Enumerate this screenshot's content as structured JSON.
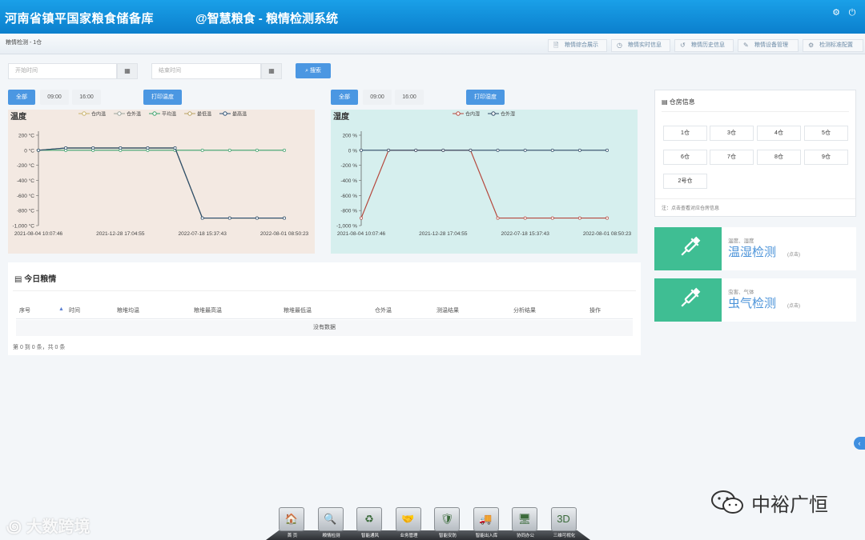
{
  "header": {
    "org_title": "河南省镇平国家粮食储备库",
    "system_title": "@智慧粮食 - 粮情检测系统"
  },
  "subbar": {
    "breadcrumb": "粮情检测 - 1仓",
    "tabs": [
      {
        "label": "粮情综合展示",
        "icon": "document-icon"
      },
      {
        "label": "粮情实时信息",
        "icon": "clock-icon"
      },
      {
        "label": "粮情历史信息",
        "icon": "history-icon"
      },
      {
        "label": "粮情设备管理",
        "icon": "wrench-icon"
      },
      {
        "label": "检测标准配置",
        "icon": "gear-icon"
      }
    ]
  },
  "search": {
    "start_placeholder": "开始时间",
    "end_placeholder": "结束时间",
    "button_label": "搜索"
  },
  "temp_controls": {
    "all": "全部",
    "t1": "09:00",
    "t2": "16:00",
    "print": "打印温度"
  },
  "hum_controls": {
    "all": "全部",
    "t1": "09:00",
    "t2": "16:00",
    "print": "打印湿度"
  },
  "chart_data": [
    {
      "type": "line",
      "title": "温度",
      "background": "#f3e9e2",
      "x": [
        "2021-08-04 10:07:46",
        "",
        "",
        "2021-12-28 17:04:55",
        "",
        "",
        "2022-07-18 15:37:43",
        "",
        "",
        "2022-08-01 08:50:23"
      ],
      "x_tick_labels": [
        "2021-08-04 10:07:46",
        "2021-12-28 17:04:55",
        "2022-07-18 15:37:43",
        "2022-08-01 08:50:23"
      ],
      "y_ticks": [
        "200 °C",
        "0 °C",
        "-200 °C",
        "-400 °C",
        "-600 °C",
        "-800 °C",
        "-1,000 °C"
      ],
      "ylim": [
        -1000,
        200
      ],
      "legend": [
        "仓内温",
        "仓外温",
        "平均温",
        "最低温",
        "最高温"
      ],
      "series": [
        {
          "name": "仓内温",
          "color": "#c8b26a",
          "values": [
            0,
            30,
            30,
            30,
            30,
            30,
            -900,
            -900,
            -900,
            -900
          ]
        },
        {
          "name": "仓外温",
          "color": "#9aa39a",
          "values": [
            0,
            30,
            30,
            30,
            30,
            30,
            -900,
            -900,
            -900,
            -900
          ]
        },
        {
          "name": "平均温",
          "color": "#3aa06a",
          "values": [
            0,
            0,
            0,
            0,
            0,
            0,
            0,
            0,
            0,
            0
          ]
        },
        {
          "name": "最低温",
          "color": "#b8a060",
          "values": [
            0,
            30,
            30,
            30,
            30,
            30,
            -900,
            -900,
            -900,
            -900
          ]
        },
        {
          "name": "最高温",
          "color": "#2b4f73",
          "values": [
            0,
            30,
            30,
            30,
            30,
            30,
            -900,
            -900,
            -900,
            -900
          ]
        }
      ]
    },
    {
      "type": "line",
      "title": "湿度",
      "background": "#d6efee",
      "x": [
        "2021-08-04 10:07:46",
        "",
        "",
        "2021-12-28 17:04:55",
        "",
        "",
        "2022-07-18 15:37:43",
        "",
        "",
        "2022-08-01 08:50:23"
      ],
      "x_tick_labels": [
        "2021-08-04 10:07:46",
        "2021-12-28 17:04:55",
        "2022-07-18 15:37:43",
        "2022-08-01 08:50:23"
      ],
      "y_ticks": [
        "200 %",
        "0 %",
        "-200 %",
        "-400 %",
        "-600 %",
        "-800 %",
        "-1,000 %"
      ],
      "ylim": [
        -1000,
        200
      ],
      "legend": [
        "仓内湿",
        "仓外湿"
      ],
      "series": [
        {
          "name": "仓内湿",
          "color": "#b5473c",
          "values": [
            -900,
            0,
            0,
            0,
            0,
            -900,
            -900,
            -900,
            -900,
            -900
          ]
        },
        {
          "name": "仓外湿",
          "color": "#2f4a66",
          "values": [
            0,
            0,
            0,
            0,
            0,
            0,
            0,
            0,
            0,
            0
          ]
        }
      ]
    }
  ],
  "today": {
    "title": "今日粮情",
    "columns": [
      "序号",
      "时间",
      "粮堆均温",
      "粮堆最高温",
      "粮堆最低温",
      "仓外温",
      "测温结果",
      "分析结果",
      "操作"
    ],
    "empty_text": "没有数据",
    "footer": "第 0 到 0 条，共 0 条"
  },
  "warehouse": {
    "title": "仓房信息",
    "buttons": [
      "1仓",
      "3仓",
      "4仓",
      "5仓",
      "6仓",
      "7仓",
      "8仓",
      "9仓",
      "2号仓"
    ],
    "note": "注：点击查看对应仓房信息"
  },
  "detect": [
    {
      "sub": "温度、湿度",
      "main": "温湿检测",
      "hint": "(点击)"
    },
    {
      "sub": "虫害、气体",
      "main": "虫气检测",
      "hint": "(点击)"
    }
  ],
  "dock": [
    "首 页",
    "粮情检测",
    "智能通风",
    "业务管理",
    "智能安防",
    "智能出入库",
    "协同办公",
    "三维可视化"
  ],
  "watermarks": {
    "left": "大数跨境",
    "right": "中裕广恒"
  },
  "colors": {
    "header": "#0b7fcd",
    "accent": "#4b97e2",
    "green": "#3fbe93"
  }
}
